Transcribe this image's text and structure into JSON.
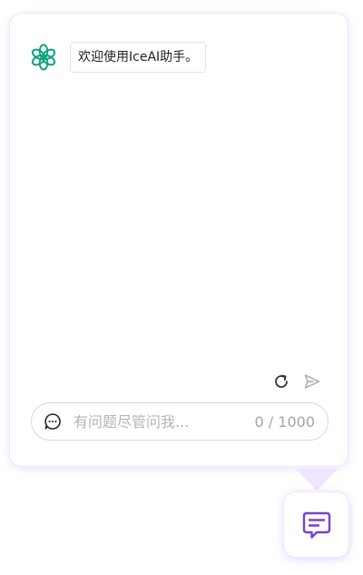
{
  "chat": {
    "assistant_message": "欢迎使用IceAI助手。"
  },
  "input": {
    "placeholder": "有问题尽管问我...",
    "value": "",
    "counter": "0 / 1000"
  },
  "icons": {
    "avatar": "openai-logo-icon",
    "refresh": "refresh-icon",
    "send": "send-icon",
    "input_prefix": "chat-bubble-icon",
    "toggle": "message-square-icon"
  },
  "colors": {
    "avatar_green": "#10a37f",
    "accent_purple": "#7a3fd6",
    "panel_border": "#ece6fb"
  }
}
